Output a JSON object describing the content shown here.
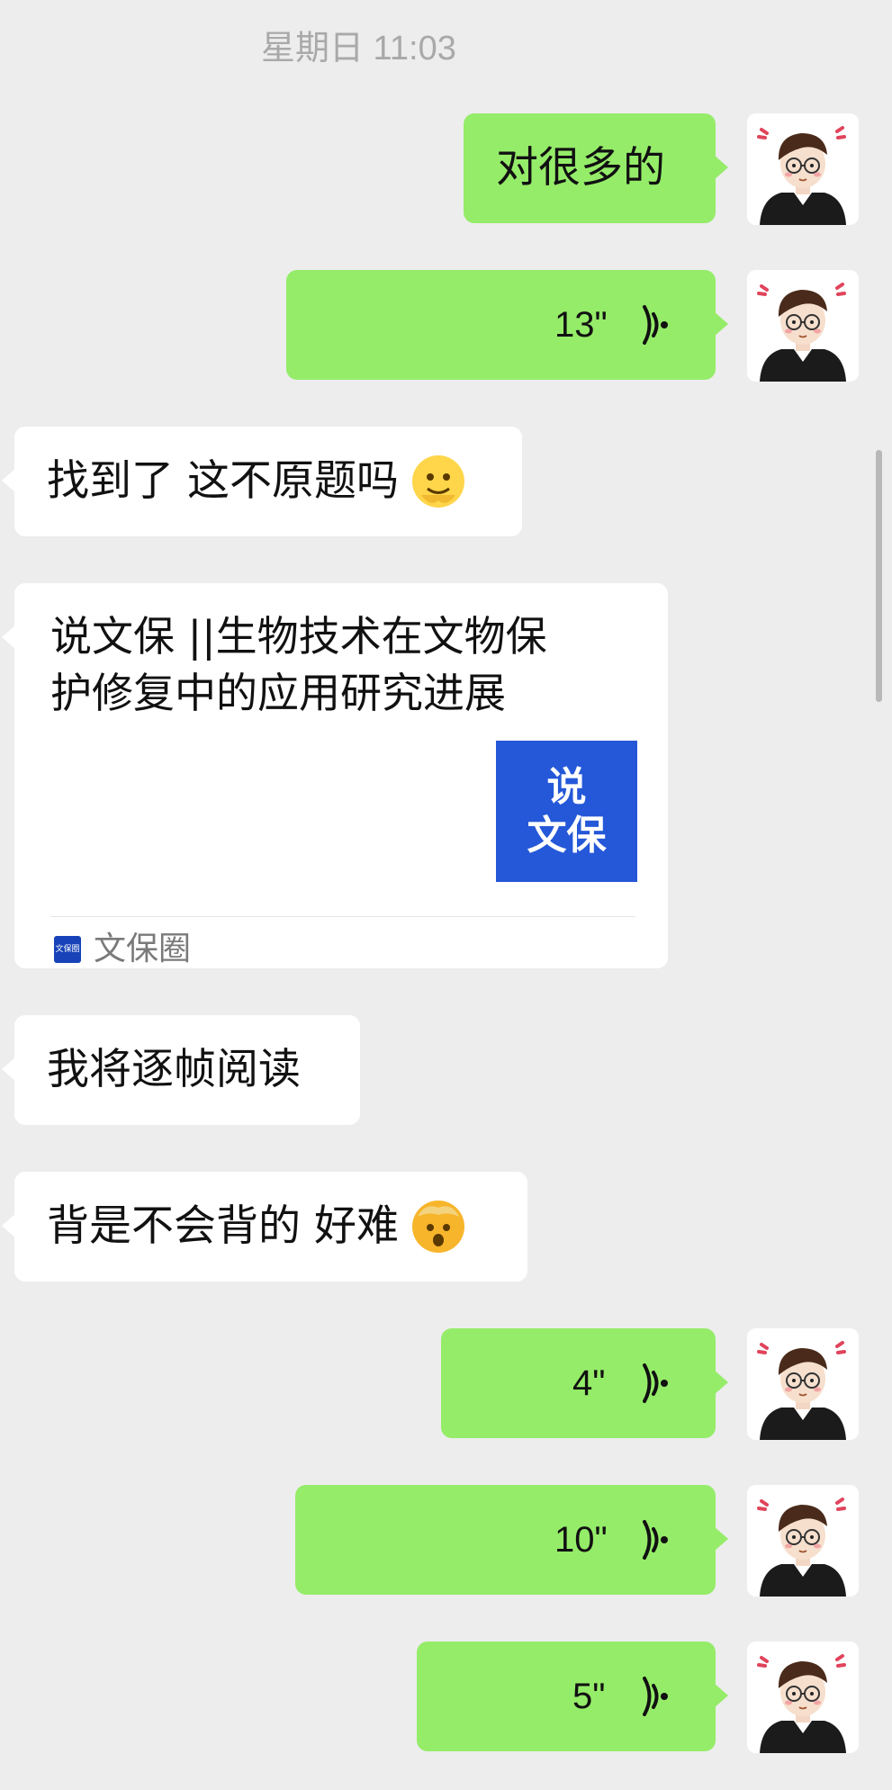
{
  "chat": {
    "timestamp": "星期日 11:03",
    "messages": [
      {
        "side": "right",
        "type": "text",
        "text": "对很多的"
      },
      {
        "side": "right",
        "type": "voice",
        "duration": "13\""
      },
      {
        "side": "left",
        "type": "text",
        "text": "找到了 这不原题吗",
        "emoji": "melting-face"
      },
      {
        "side": "left",
        "type": "link",
        "title": "说文保 || 生物技术在文物保护修复中的应用研究进展",
        "title_line1": "说文保 ||生物技术在文物保",
        "title_line2": "护修复中的应用研究进展",
        "thumb_line1": "说",
        "thumb_line2": "文保",
        "source_icon_text": "文保圈",
        "source": "文保圈"
      },
      {
        "side": "left",
        "type": "text",
        "text": "我将逐帧阅读"
      },
      {
        "side": "left",
        "type": "text",
        "text": "背是不会背的 好难",
        "emoji": "exploding-head"
      },
      {
        "side": "right",
        "type": "voice",
        "duration": "4\""
      },
      {
        "side": "right",
        "type": "voice",
        "duration": "10\""
      },
      {
        "side": "right",
        "type": "voice",
        "duration": "5\""
      }
    ]
  },
  "colors": {
    "background": "#ededed",
    "self_bubble": "#95ec69",
    "other_bubble": "#ffffff",
    "timestamp_text": "#a9a9a9",
    "thumbnail": "#2558d8"
  },
  "icons": {
    "voice": "voice-wave-icon",
    "avatar": "cartoon-avatar",
    "source": "wenbaoquan-logo-icon"
  }
}
